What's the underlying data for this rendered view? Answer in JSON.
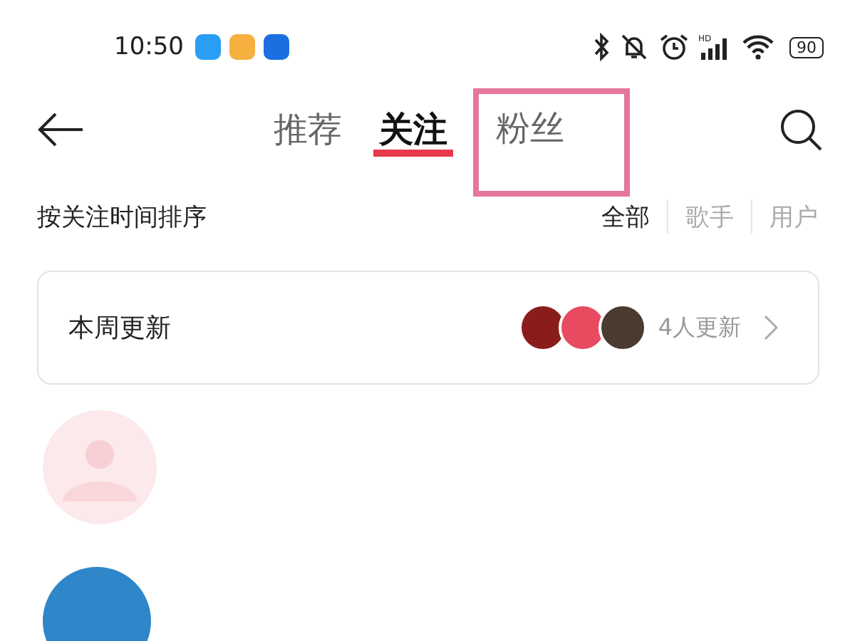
{
  "status_bar": {
    "time": "10:50",
    "notification_apps": [
      {
        "color": "#2a9df4"
      },
      {
        "color": "#f5b040"
      },
      {
        "color": "#1b6fe0"
      }
    ],
    "network_label": "HD",
    "battery": "90"
  },
  "tabs": [
    {
      "label": "推荐",
      "selected": false,
      "highlighted": false
    },
    {
      "label": "关注",
      "selected": true,
      "highlighted": false
    },
    {
      "label": "粉丝",
      "selected": false,
      "highlighted": true
    }
  ],
  "sort_label": "按关注时间排序",
  "filters": [
    {
      "label": "全部",
      "selected": true
    },
    {
      "label": "歌手",
      "selected": false
    },
    {
      "label": "用户",
      "selected": false
    }
  ],
  "weekly_update": {
    "title": "本周更新",
    "avatars": [
      {
        "color": "#8a1c1c"
      },
      {
        "color": "#e84a5f"
      },
      {
        "color": "#4a3a30"
      }
    ],
    "count": "4人更新"
  },
  "list": [
    {
      "kind": "placeholder"
    },
    {
      "kind": "photo"
    }
  ]
}
